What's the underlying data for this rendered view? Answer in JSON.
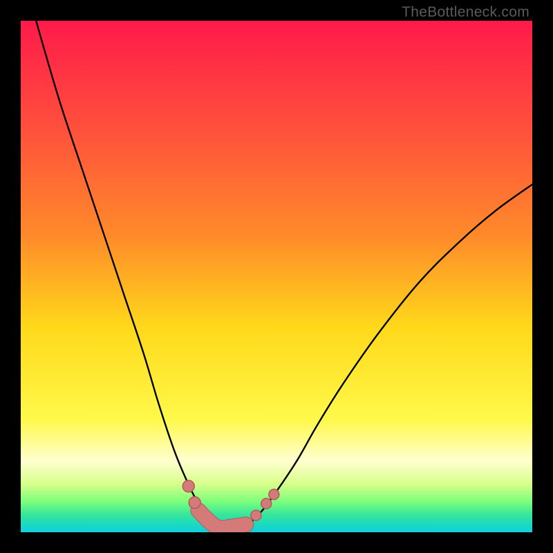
{
  "watermark": "TheBottleneck.com",
  "chart_data": {
    "type": "line",
    "title": "",
    "xlabel": "",
    "ylabel": "",
    "xlim": [
      0,
      100
    ],
    "ylim": [
      0,
      100
    ],
    "grid": false,
    "legend": false,
    "gradient_stops": [
      {
        "offset": 0.0,
        "color": "#ff1a4a"
      },
      {
        "offset": 0.2,
        "color": "#ff4d3d"
      },
      {
        "offset": 0.42,
        "color": "#ff8a2a"
      },
      {
        "offset": 0.6,
        "color": "#ffd91a"
      },
      {
        "offset": 0.78,
        "color": "#fff94a"
      },
      {
        "offset": 0.86,
        "color": "#ffffd0"
      },
      {
        "offset": 0.905,
        "color": "#d8ff8a"
      },
      {
        "offset": 0.94,
        "color": "#7cff7c"
      },
      {
        "offset": 0.965,
        "color": "#38e59a"
      },
      {
        "offset": 0.985,
        "color": "#1adac0"
      },
      {
        "offset": 1.0,
        "color": "#12cfe0"
      }
    ],
    "series": [
      {
        "name": "left-dip",
        "stroke": "#000000",
        "x": [
          3,
          5,
          8,
          12,
          16,
          20,
          24,
          27,
          30,
          32.5,
          34.5,
          36.5,
          38.5
        ],
        "y": [
          100,
          93,
          83,
          71,
          59,
          47,
          35,
          25,
          16,
          10,
          6,
          3.2,
          1.0
        ]
      },
      {
        "name": "right-rise",
        "stroke": "#000000",
        "x": [
          44,
          47,
          50,
          54,
          58,
          63,
          70,
          78,
          86,
          93,
          100
        ],
        "y": [
          1.0,
          4,
          8,
          14,
          21,
          29,
          39,
          49,
          57,
          63,
          68
        ]
      },
      {
        "name": "floor-link",
        "stroke": "#000000",
        "x": [
          38.5,
          44
        ],
        "y": [
          1.0,
          1.0
        ]
      }
    ],
    "marker_series": {
      "name": "pink-markers",
      "fill": "#d47b7a",
      "stroke": "#b25a59",
      "worm": {
        "x": [
          34.7,
          38.2,
          41.3,
          44.0
        ],
        "y": [
          4.3,
          1.1,
          1.1,
          1.5
        ]
      },
      "dots": [
        {
          "x": 32.8,
          "y": 9.0,
          "r": 8.5
        },
        {
          "x": 34.0,
          "y": 5.8,
          "r": 8.5
        },
        {
          "x": 46.0,
          "y": 3.3,
          "r": 7.5
        },
        {
          "x": 48.0,
          "y": 5.6,
          "r": 7.5
        },
        {
          "x": 49.5,
          "y": 7.4,
          "r": 7.5
        }
      ]
    }
  }
}
